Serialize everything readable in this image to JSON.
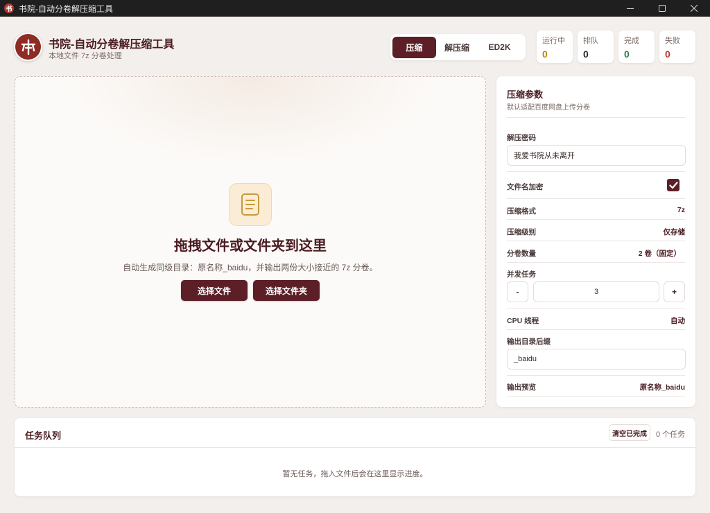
{
  "window": {
    "title": "书院-自动分卷解压缩工具",
    "app_icon_glyph": "书"
  },
  "header": {
    "title": "书院-自动分卷解压缩工具",
    "subtitle": "本地文件 7z 分卷处理"
  },
  "modes": [
    {
      "label": "压缩",
      "active": true
    },
    {
      "label": "解压缩",
      "active": false
    },
    {
      "label": "ED2K",
      "active": false
    }
  ],
  "stats": [
    {
      "label": "运行中",
      "value": "0",
      "color": "#b8860b"
    },
    {
      "label": "排队",
      "value": "0",
      "color": "#2a2a2a"
    },
    {
      "label": "完成",
      "value": "0",
      "color": "#2e7d4f"
    },
    {
      "label": "失败",
      "value": "0",
      "color": "#b23a2e"
    }
  ],
  "dropzone": {
    "title": "拖拽文件或文件夹到这里",
    "hint": "自动生成同级目录：原名称_baidu，并输出两份大小接近的 7z 分卷。",
    "select_file": "选择文件",
    "select_folder": "选择文件夹"
  },
  "settings": {
    "title": "压缩参数",
    "subtitle": "默认适配百度网盘上传分卷",
    "password_label": "解压密码",
    "password_value": "我爱书院从未离开",
    "encrypt_names_label": "文件名加密",
    "encrypt_names_checked": true,
    "format_label": "压缩格式",
    "format_value": "7z",
    "level_label": "压缩级别",
    "level_value": "仅存储",
    "volumes_label": "分卷数量",
    "volumes_value": "2 卷（固定）",
    "concurrency_label": "并发任务",
    "concurrency_minus": "-",
    "concurrency_value": "3",
    "concurrency_plus": "+",
    "cpu_label": "CPU 线程",
    "cpu_value": "自动",
    "suffix_label": "输出目录后缀",
    "suffix_value": "_baidu",
    "preview_label": "输出预览",
    "preview_value": "原名称_baidu"
  },
  "queue": {
    "title": "任务队列",
    "clear_label": "清空已完成",
    "count": "0 个任务",
    "empty": "暂无任务，拖入文件后会在这里显示进度。"
  },
  "colors": {
    "accent": "#5c1f27",
    "background": "#f3efec"
  }
}
